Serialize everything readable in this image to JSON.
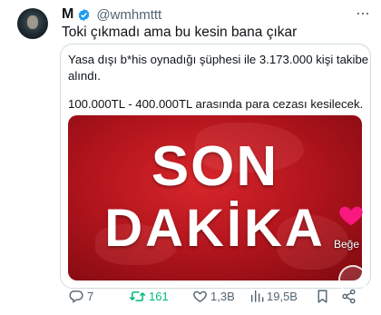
{
  "author": {
    "name": "M",
    "handle": "@wmhmttt"
  },
  "tweet": {
    "text": "Toki çıkmadı ama bu kesin bana çıkar"
  },
  "quote": {
    "line1": "Yasa dışı b*his oynadığı şüphesi ile 3.173.000 kişi takibe",
    "line2": "alındı.",
    "line3": "100.000TL - 400.000TL arasında para cezası kesilecek.",
    "image_text_top": "SON",
    "image_text_bottom": "DAKİKA"
  },
  "overlay": {
    "like_label": "Beğe"
  },
  "actions": {
    "replies": "7",
    "retweets": "161",
    "likes": "1,3B",
    "views": "19,5B"
  },
  "icons": {
    "verified": "verified-badge-icon",
    "more": "more-dots-icon",
    "reply": "reply-icon",
    "retweet": "retweet-icon",
    "like": "heart-icon",
    "views": "views-icon",
    "bookmark": "bookmark-icon",
    "share": "share-icon"
  },
  "colors": {
    "verified": "#1d9bf0",
    "retweet_active": "#00ba7c",
    "banner_red": "#c8161d",
    "overlay_heart": "#f91880"
  }
}
